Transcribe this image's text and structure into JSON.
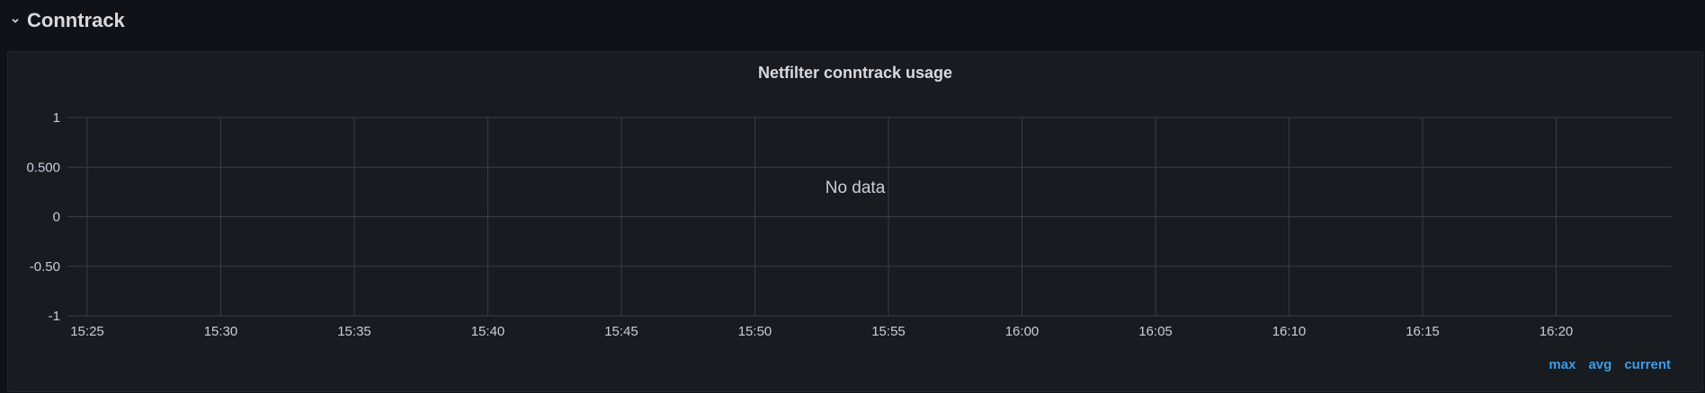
{
  "row": {
    "title": "Conntrack",
    "chevron_icon": "chevron-down-icon"
  },
  "panel": {
    "title": "Netfilter conntrack usage",
    "no_data_text": "No data",
    "legend": {
      "max_label": "max",
      "avg_label": "avg",
      "current_label": "current"
    }
  },
  "colors": {
    "background": "#111217",
    "panel": "#181b1f",
    "grid": "#3a3d44",
    "text": "#ccccdc",
    "accent": "#3d9be6"
  },
  "chart_data": {
    "type": "line",
    "title": "Netfilter conntrack usage",
    "x": [
      "15:25",
      "15:30",
      "15:35",
      "15:40",
      "15:45",
      "15:50",
      "15:55",
      "16:00",
      "16:05",
      "16:10",
      "16:15",
      "16:20"
    ],
    "y_ticks": [
      "1",
      "0.500",
      "0",
      "-0.50",
      "-1"
    ],
    "ylim": [
      -1,
      1
    ],
    "series": [],
    "grid": true,
    "annotation": "No data",
    "legend_placement": "bottom-right"
  }
}
